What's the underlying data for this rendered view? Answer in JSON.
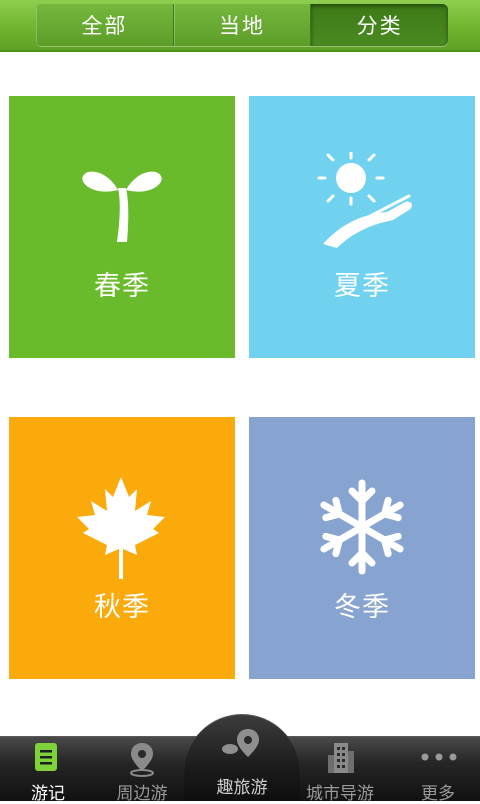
{
  "tabs": [
    {
      "label": "全部",
      "active": false
    },
    {
      "label": "当地",
      "active": false
    },
    {
      "label": "分类",
      "active": true
    }
  ],
  "seasons": [
    {
      "label": "春季",
      "icon": "sprout-icon",
      "color": "#6abb2b"
    },
    {
      "label": "夏季",
      "icon": "sun-icon",
      "color": "#71d2f0"
    },
    {
      "label": "秋季",
      "icon": "maple-leaf-icon",
      "color": "#fbaa0c"
    },
    {
      "label": "冬季",
      "icon": "snowflake-icon",
      "color": "#87a3cf"
    }
  ],
  "bottom_nav": [
    {
      "label": "游记",
      "icon": "notes-icon",
      "active": true
    },
    {
      "label": "周边游",
      "icon": "location-pin-icon",
      "active": false
    },
    {
      "label": "趣旅游",
      "icon": "map-pin-icon",
      "active": false
    },
    {
      "label": "城市导游",
      "icon": "city-building-icon",
      "active": false
    },
    {
      "label": "更多",
      "icon": "more-dots-icon",
      "active": false
    }
  ],
  "colors": {
    "brand_green": "#6fb52f",
    "active_nav_icon": "#7ed23a"
  }
}
